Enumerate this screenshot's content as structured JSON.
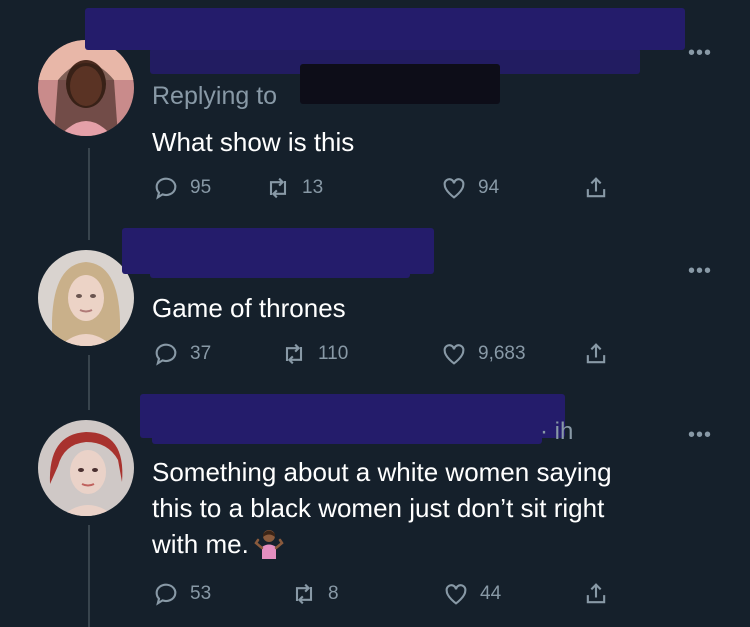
{
  "tweets": [
    {
      "replying_label": "Replying to",
      "text": "What show is this",
      "stats": {
        "replies": "95",
        "retweets": "13",
        "likes": "94"
      },
      "more_label": "•••"
    },
    {
      "text": "Game of thrones",
      "stats": {
        "replies": "37",
        "retweets": "110",
        "likes": "9,683"
      },
      "more_label": "•••"
    },
    {
      "handle_fragment": "·  ih",
      "text_lines": [
        "Something about a white women saying",
        "this to a black women just don’t sit right",
        "with me."
      ],
      "emoji": "person-shrugging-emoji",
      "stats": {
        "replies": "53",
        "retweets": "8",
        "likes": "44"
      },
      "more_label": "•••"
    }
  ],
  "colors": {
    "background": "#15202b",
    "muted": "#8899a6",
    "redaction": "#241c6b"
  },
  "icons": [
    "reply-icon",
    "retweet-icon",
    "like-icon",
    "share-icon"
  ]
}
